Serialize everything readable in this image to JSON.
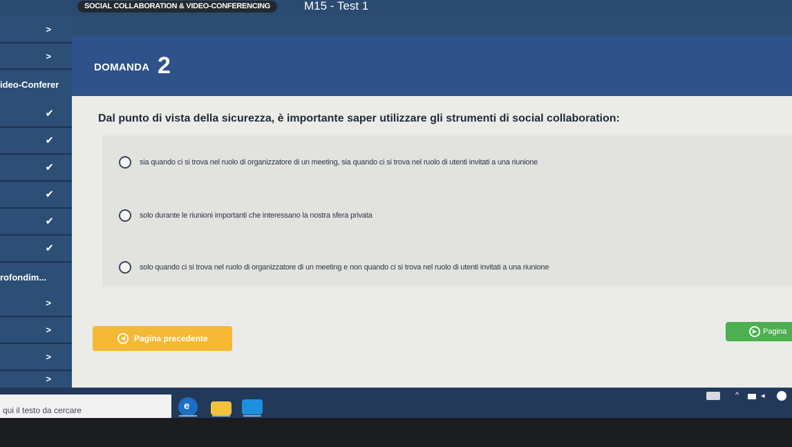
{
  "header": {
    "course_title": "SOCIAL COLLABORATION & VIDEO-CONFERENCING",
    "test_title": "M15 - Test 1"
  },
  "sidebar": {
    "section_label": "ideo-Conferer",
    "link_label": "rofondim...",
    "arrow_glyph": ">",
    "check_glyph": "✔"
  },
  "question": {
    "label": "DOMANDA",
    "number": "2",
    "text": "Dal punto di vista della sicurezza, è importante saper utilizzare gli strumenti di social collaboration:",
    "answers": [
      "sia quando ci si trova nel ruolo di organizzatore di un meeting, sia quando ci si trova nel ruolo di utenti invitati a una riunione",
      "solo durante le riunioni importanti che interessano la nostra sfera privata",
      "solo quando ci si trova nel ruolo di organizzatore di un meeting e non quando ci si trova nel ruolo di utenti invitati a una riunione"
    ]
  },
  "navigation": {
    "prev_label": "Pagina precedente",
    "next_label": "Pagina"
  },
  "taskbar": {
    "search_placeholder": "qui il testo da cercare"
  },
  "colors": {
    "header_blue": "#2e5289",
    "prev_button": "#f6b935",
    "next_button": "#4caf50"
  }
}
